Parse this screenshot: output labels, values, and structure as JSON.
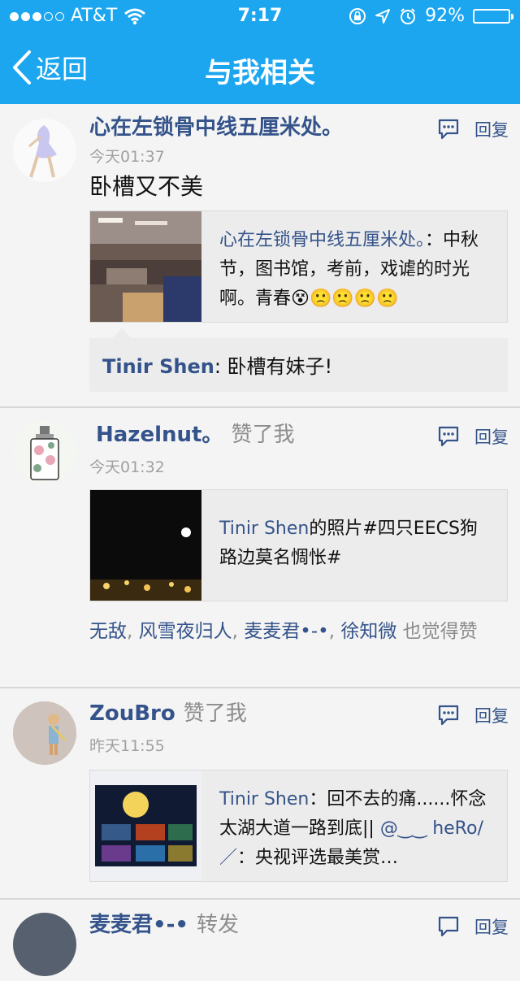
{
  "status_bar": {
    "carrier": "AT&T",
    "time": "7:17",
    "battery": "92%",
    "battery_fraction": 0.92
  },
  "nav": {
    "back_label": "返回",
    "title": "与我相关"
  },
  "items": [
    {
      "user": "心在左锁骨中线五厘米处。",
      "time": "今天01:37",
      "reply_label": "回复",
      "text": "卧槽又不美",
      "card": {
        "user": "心在左锁骨中线五厘米处。",
        "sep": "：",
        "text": "中秋节，图书馆，考前，戏谑的时光啊。青春",
        "emoji": [
          "😵",
          "🙁",
          "🙁",
          "🙁",
          "🙁"
        ]
      },
      "comment": {
        "user": "Tinir Shen",
        "text": ": 卧槽有妹子!"
      }
    },
    {
      "user": "Hazelnut。",
      "action": "赞了我",
      "time": "今天01:32",
      "reply_label": "回复",
      "card": {
        "user": "Tinir Shen",
        "text": "的照片#四只EECS狗路边莫名惆怅#"
      },
      "likes": {
        "users": [
          "无敌",
          "风雪夜归人",
          "麦麦君•-•",
          "徐知微"
        ],
        "separator": ", ",
        "suffix": " 也觉得赞"
      }
    },
    {
      "user": "ZouBro",
      "action": "赞了我",
      "time": "昨天11:55",
      "reply_label": "回复",
      "card": {
        "user": "Tinir Shen",
        "text": "：回不去的痛......怀念太湖大道一路到底||",
        "mention": "@‿‿",
        "user2": "heRo/／",
        "text2": "：央视评选最美赏…"
      }
    },
    {
      "user": "麦麦君•-•",
      "action": "转发",
      "reply_label": "回复"
    }
  ]
}
